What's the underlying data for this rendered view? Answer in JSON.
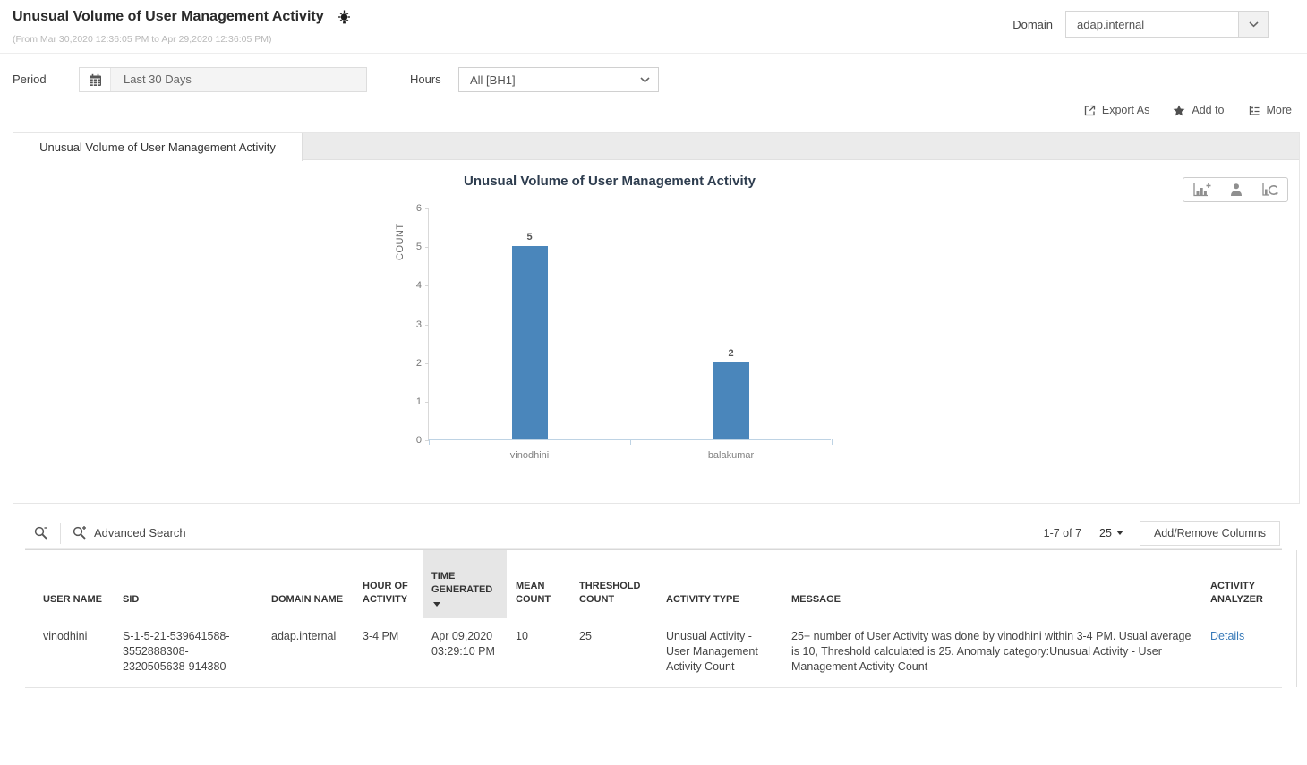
{
  "page": {
    "title": "Unusual Volume of User Management Activity",
    "subtitle": "(From Mar 30,2020 12:36:05 PM to Apr 29,2020 12:36:05 PM)"
  },
  "domain": {
    "label": "Domain",
    "value": "adap.internal"
  },
  "filters": {
    "period": {
      "label": "Period",
      "value": "Last 30 Days"
    },
    "hours": {
      "label": "Hours",
      "value": "All [BH1]"
    }
  },
  "actions": {
    "export_as": "Export As",
    "add_to": "Add to",
    "more": "More"
  },
  "tab": {
    "label": "Unusual Volume of User Management Activity"
  },
  "chart_data": {
    "type": "bar",
    "title": "Unusual Volume of User Management Activity",
    "categories": [
      "vinodhini",
      "balakumar"
    ],
    "values": [
      5,
      2
    ],
    "xlabel": "",
    "ylabel": "COUNT",
    "ylim": [
      0,
      6
    ],
    "yticks": [
      0,
      1,
      2,
      3,
      4,
      5,
      6
    ],
    "bar_color": "#4a86bb",
    "grid": false,
    "legend": false,
    "data_labels": true
  },
  "table": {
    "toolbar": {
      "advanced_search": "Advanced Search",
      "range": "1-7 of 7",
      "page_size": "25",
      "add_remove_columns": "Add/Remove Columns"
    },
    "columns": [
      "USER NAME",
      "SID",
      "DOMAIN NAME",
      "HOUR OF ACTIVITY",
      "TIME GENERATED",
      "MEAN COUNT",
      "THRESHOLD COUNT",
      "ACTIVITY TYPE",
      "MESSAGE",
      "ACTIVITY ANALYZER"
    ],
    "sort": {
      "column": "TIME GENERATED",
      "direction": "desc"
    },
    "rows": [
      {
        "user_name": "vinodhini",
        "sid": "S-1-5-21-539641588-3552888308-2320505638-914380",
        "domain_name": "adap.internal",
        "hour_of_activity": "3-4 PM",
        "time_generated": "Apr 09,2020 03:29:10 PM",
        "mean_count": "10",
        "threshold_count": "25",
        "activity_type": "Unusual Activity - User Management Activity Count",
        "message": "25+ number of User Activity was done by vinodhini within 3-4 PM. Usual average is 10, Threshold calculated is 25. Anomaly category:Unusual Activity - User Management Activity Count",
        "activity_analyzer": "Details"
      }
    ]
  },
  "colors": {
    "bar": "#4a86bb",
    "link": "#3779b8",
    "header_highlight": "#e6e6e6",
    "axis_line": "#bed3e4"
  },
  "icons": {
    "bulb-icon": "radiant-lightbulb",
    "calendar-icon": "calendar-grid",
    "chevron-down-icon": "chevron-down",
    "export-icon": "box-with-arrow",
    "star-icon": "solid-star",
    "more-icon": "list-tree",
    "chart-add-icon": "bar-chart-plus",
    "person-icon": "user-silhouette",
    "chart-refresh-icon": "bar-chart-refresh",
    "search-icon": "magnifier",
    "advanced-search-icon": "magnifier-plus",
    "sort-caret-icon": "caret-down"
  }
}
